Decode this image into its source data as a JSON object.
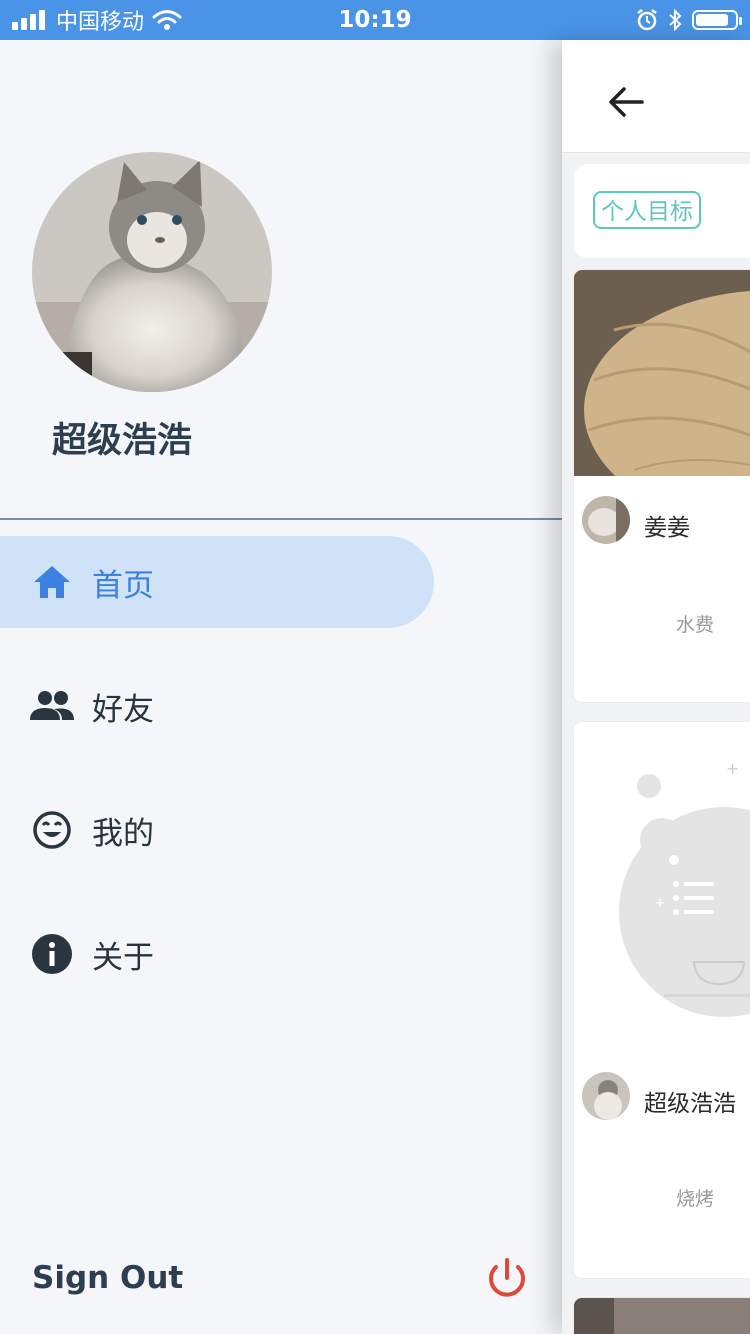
{
  "status_bar": {
    "carrier": "中国移动",
    "time": "10:19",
    "battery_level": 0.85
  },
  "drawer": {
    "user_name": "超级浩浩",
    "menu": [
      {
        "label": "首页",
        "icon": "home-icon",
        "active": true
      },
      {
        "label": "好友",
        "icon": "people-icon",
        "active": false
      },
      {
        "label": "我的",
        "icon": "smile-icon",
        "active": false
      },
      {
        "label": "关于",
        "icon": "info-icon",
        "active": false
      }
    ],
    "sign_out_label": "Sign Out"
  },
  "main": {
    "goal_tag": "个人目标",
    "posts": [
      {
        "user": "姜姜",
        "text": "水费"
      },
      {
        "user": "超级浩浩",
        "text": "烧烤"
      }
    ]
  },
  "colors": {
    "status_bar": "#4a94e8",
    "active_menu_bg": "#cfe2f7",
    "active_menu_text": "#3b82e0",
    "goal_tag": "#5fc6c0",
    "power_icon": "#e0483a"
  }
}
